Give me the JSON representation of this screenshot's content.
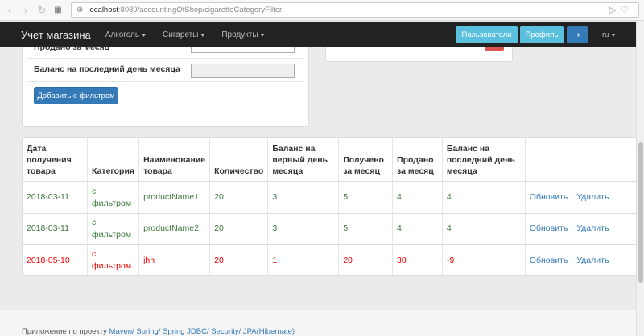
{
  "browser": {
    "url_host": "localhost",
    "url_path": ":8080/accountingOfShop/cigaretteCategoryFilter"
  },
  "navbar": {
    "brand": "Учет магазина",
    "menus": [
      "Алкоголь",
      "Сигареты",
      "Продукты"
    ],
    "users_btn": "Пользователи",
    "profile_btn": "Профиль",
    "lang": "ru"
  },
  "form": {
    "partial_label": "Продано за месяц",
    "balance_label": "Баланс на последний день месяца",
    "add_button": "Добавить с фильтром"
  },
  "table": {
    "headers": [
      "Дата получения товара",
      "Категория",
      "Наименование товара",
      "Количество",
      "Баланс на первый день месяца",
      "Получено за месяц",
      "Продано за месяц",
      "Баланс на последний день месяца",
      "",
      ""
    ],
    "rows": [
      {
        "date": "2018-03-11",
        "category": "с фильтром",
        "name": "productName1",
        "qty": "20",
        "first": "3",
        "received": "5",
        "sold": "4",
        "last": "4",
        "update": "Обновить",
        "delete": "Удалить"
      },
      {
        "date": "2018-03-11",
        "category": "с фильтром",
        "name": "productName2",
        "qty": "20",
        "first": "3",
        "received": "5",
        "sold": "4",
        "last": "4",
        "update": "Обновить",
        "delete": "Удалить"
      },
      {
        "date": "2018-05-10",
        "category": "с фильтром",
        "name": "jhh",
        "qty": "20",
        "first": "1",
        "received": "20",
        "sold": "30",
        "last": "-9",
        "update": "Обновить",
        "delete": "Удалить"
      }
    ]
  },
  "footer": {
    "text": "Приложение по проекту",
    "links": "Maven/ Spring/ Spring JDBC/ Security/ JPA(Hibernate)"
  }
}
